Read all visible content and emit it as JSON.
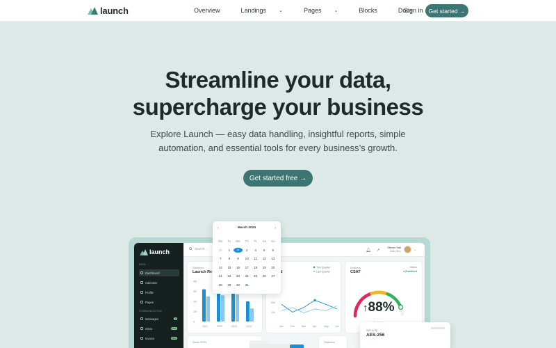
{
  "nav": {
    "brand": "launch",
    "menu": [
      {
        "label": "Overview",
        "dropdown": false
      },
      {
        "label": "Landings",
        "dropdown": true
      },
      {
        "label": "Pages",
        "dropdown": true
      },
      {
        "label": "Blocks",
        "dropdown": false
      },
      {
        "label": "Docs",
        "dropdown": false
      }
    ],
    "signin": "Sign in",
    "cta": "Get started →"
  },
  "hero": {
    "title_line1": "Streamline your data,",
    "title_line2": "supercharge your business",
    "subtitle_line1": "Explore Launch — easy data handling, insightful reports, simple",
    "subtitle_line2": "automation, and essential tools for every business’s growth.",
    "cta": "Get started free →"
  },
  "colors": {
    "accent": "#3c7571",
    "background": "#dde9e7",
    "sidebar": "#15201f",
    "chart_blue": "#1a8fd6"
  },
  "preview": {
    "sidebar": {
      "brand": "launch",
      "section_main": "MAIN",
      "items_main": [
        {
          "label": "Dashboard",
          "icon": "grid-icon",
          "active": true
        },
        {
          "label": "Calendar",
          "icon": "calendar-icon"
        },
        {
          "label": "Profile",
          "icon": "user-icon"
        },
        {
          "label": "Pages",
          "icon": "page-icon"
        }
      ],
      "section_comm": "COMMUNICATION",
      "items_comm": [
        {
          "label": "Messages",
          "icon": "message-icon",
          "badge": "6"
        },
        {
          "label": "Inbox",
          "icon": "inbox-icon",
          "badge": "New"
        },
        {
          "label": "Invoice",
          "icon": "invoice-icon",
          "badge": "New"
        }
      ]
    },
    "topbar": {
      "search_placeholder": "Search...",
      "user_name": "Steven Sail",
      "user_role": "Sales Hero"
    },
    "stats_card": {
      "label": "Statistics",
      "title": "Launch Re",
      "yticks": [
        "4M",
        "3M",
        "2M",
        "1M",
        "0"
      ],
      "xlabels": [
        "2021",
        "2022",
        "2023",
        "2024"
      ]
    },
    "trend_card": {
      "label": "k Trend",
      "title": "s Sold",
      "legend": [
        "This Quarter",
        "Last Quarter"
      ],
      "yticks": [
        "100k",
        "50k",
        "10k"
      ],
      "xlabels": [
        "Jan",
        "Feb",
        "Mar",
        "Apr",
        "May",
        "Jun"
      ]
    },
    "csat_card": {
      "label": "Analysis",
      "title": "CSAT",
      "status_label": "Status",
      "status": "Excellent",
      "value": "88%",
      "value_fraction": 0.88,
      "caption": "29,367 Responses"
    },
    "bottom_left_card": {
      "label": "Sales 2024"
    },
    "bottom_mid_card": {
      "label": "Statistics"
    },
    "calendar": {
      "month": "March 2024",
      "dow": [
        "Mo",
        "Tu",
        "We",
        "Th",
        "Fr",
        "Sa",
        "Su"
      ],
      "days": [
        {
          "d": "31",
          "muted": true
        },
        {
          "d": "1"
        },
        {
          "d": "2",
          "selected": true
        },
        {
          "d": "3"
        },
        {
          "d": "4"
        },
        {
          "d": "5"
        },
        {
          "d": "6"
        },
        {
          "d": "7"
        },
        {
          "d": "8"
        },
        {
          "d": "9"
        },
        {
          "d": "10"
        },
        {
          "d": "11"
        },
        {
          "d": "12"
        },
        {
          "d": "13"
        },
        {
          "d": "14"
        },
        {
          "d": "15"
        },
        {
          "d": "16"
        },
        {
          "d": "17"
        },
        {
          "d": "18"
        },
        {
          "d": "19"
        },
        {
          "d": "20"
        },
        {
          "d": "21"
        },
        {
          "d": "22"
        },
        {
          "d": "23"
        },
        {
          "d": "24"
        },
        {
          "d": "25"
        },
        {
          "d": "26"
        },
        {
          "d": "27"
        },
        {
          "d": "28"
        },
        {
          "d": "29"
        },
        {
          "d": "30"
        },
        {
          "d": "31"
        }
      ]
    },
    "security": {
      "label": "Security",
      "value": "AES-256"
    }
  },
  "chart_data": [
    {
      "type": "bar",
      "categories": [
        "2021",
        "2022",
        "2023",
        "2024"
      ],
      "series": [
        {
          "values": [
            3.2,
            3.4,
            3.3,
            2.0
          ]
        },
        {
          "values": [
            2.5,
            2.6,
            2.7,
            1.3
          ]
        }
      ],
      "ylim": [
        0,
        4
      ]
    },
    {
      "type": "line",
      "x": [
        "Jan",
        "Feb",
        "Mar",
        "Apr",
        "May",
        "Jun"
      ],
      "series": [
        {
          "name": "This Quarter",
          "values": [
            55,
            30,
            45,
            68,
            55,
            40
          ]
        },
        {
          "name": "Last Quarter",
          "values": [
            35,
            45,
            28,
            40,
            35,
            50
          ]
        }
      ],
      "ylim": [
        0,
        100
      ]
    }
  ]
}
